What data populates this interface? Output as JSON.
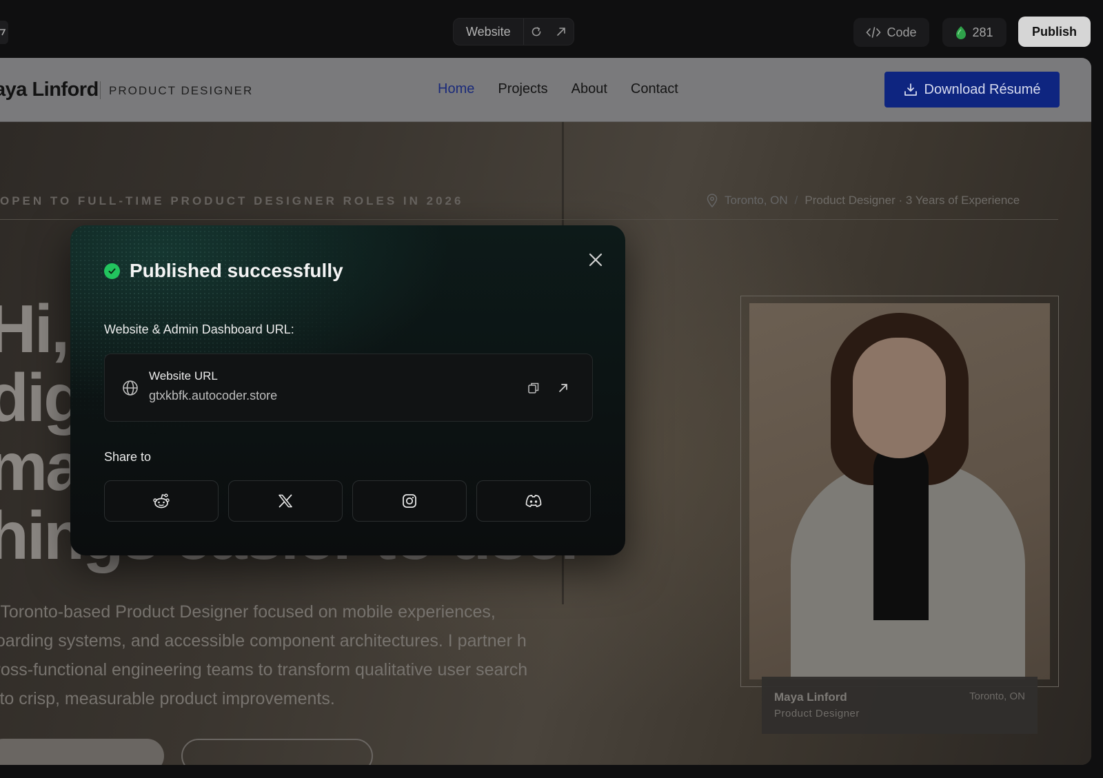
{
  "toolbar": {
    "view_label": "Website",
    "code_label": "Code",
    "credits": "281",
    "publish_label": "Publish",
    "colors": {
      "publish_bg": "#d6d6d6",
      "credit_icon": "#2fa24a"
    }
  },
  "site": {
    "brand_name": "aya Linford",
    "brand_role": "PRODUCT DESIGNER",
    "nav": [
      "Home",
      "Projects",
      "About",
      "Contact"
    ],
    "nav_active": "Home",
    "download_label": "Download Résumé",
    "hero": {
      "eyebrow": "OPEN TO FULL-TIME PRODUCT DESIGNER ROLES IN 2026",
      "location": "Toronto, ON",
      "meta_sep": "/",
      "meta_role": "Product Designer · 3 Years of Experience",
      "title_lines": [
        "Hi, I",
        "dig",
        "ma",
        "hings easier to use."
      ],
      "body": "a Toronto-based Product Designer focused on mobile experiences, boarding systems, and accessible component architectures. I partner h cross-functional engineering teams to transform qualitative user search into crisp, measurable product improvements."
    },
    "portrait_caption": {
      "name": "Maya Linford",
      "role": "Product Designer",
      "location": "Toronto, ON"
    },
    "colors": {
      "download_bg": "#0e2580",
      "nav_active": "#1a2a7a"
    }
  },
  "modal": {
    "title": "Published successfully",
    "url_section_label": "Website & Admin Dashboard URL:",
    "url_card": {
      "title": "Website URL",
      "value": "gtxkbfk.autocoder.store"
    },
    "share_label": "Share to",
    "share_targets": [
      {
        "name": "reddit",
        "icon": "reddit-icon"
      },
      {
        "name": "x",
        "icon": "x-icon"
      },
      {
        "name": "instagram",
        "icon": "instagram-icon"
      },
      {
        "name": "discord",
        "icon": "discord-icon"
      }
    ],
    "colors": {
      "success": "#22c55e"
    }
  }
}
